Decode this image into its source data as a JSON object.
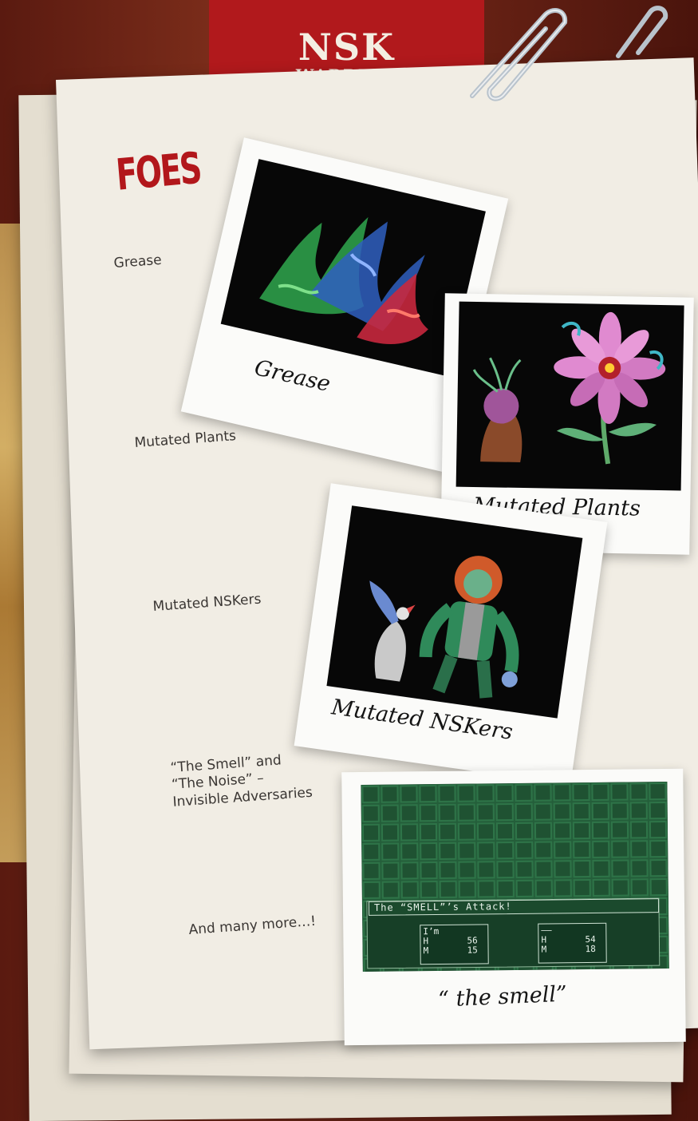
{
  "cover": {
    "logo": "NSK",
    "subtitle": "WARRIOR"
  },
  "heading": "FOES",
  "foes": [
    {
      "label": "Grease",
      "caption": "Grease"
    },
    {
      "label": "Mutated Plants",
      "caption": "Mutated Plants"
    },
    {
      "label": "Mutated NSKers",
      "caption": "Mutated NSKers"
    },
    {
      "label_lines": [
        "“The Smell” and",
        "“The Noise” –",
        "Invisible Adversaries"
      ],
      "caption": "“ the smell”"
    }
  ],
  "footer_label": "And many more…!",
  "smell_screen": {
    "message": "The “SMELL”’s Attack!",
    "party": [
      {
        "name": "I’m",
        "hp_label": "H",
        "mp_label": "M",
        "hp": "56",
        "mp": "15"
      },
      {
        "name": "——",
        "hp_label": "H",
        "mp_label": "M",
        "hp": "54",
        "mp": "18"
      }
    ]
  },
  "colors": {
    "heading": "#b2171b",
    "cover": "#b1191c",
    "paper": "#f1ede4"
  },
  "icons": [
    "paperclip-icon"
  ]
}
